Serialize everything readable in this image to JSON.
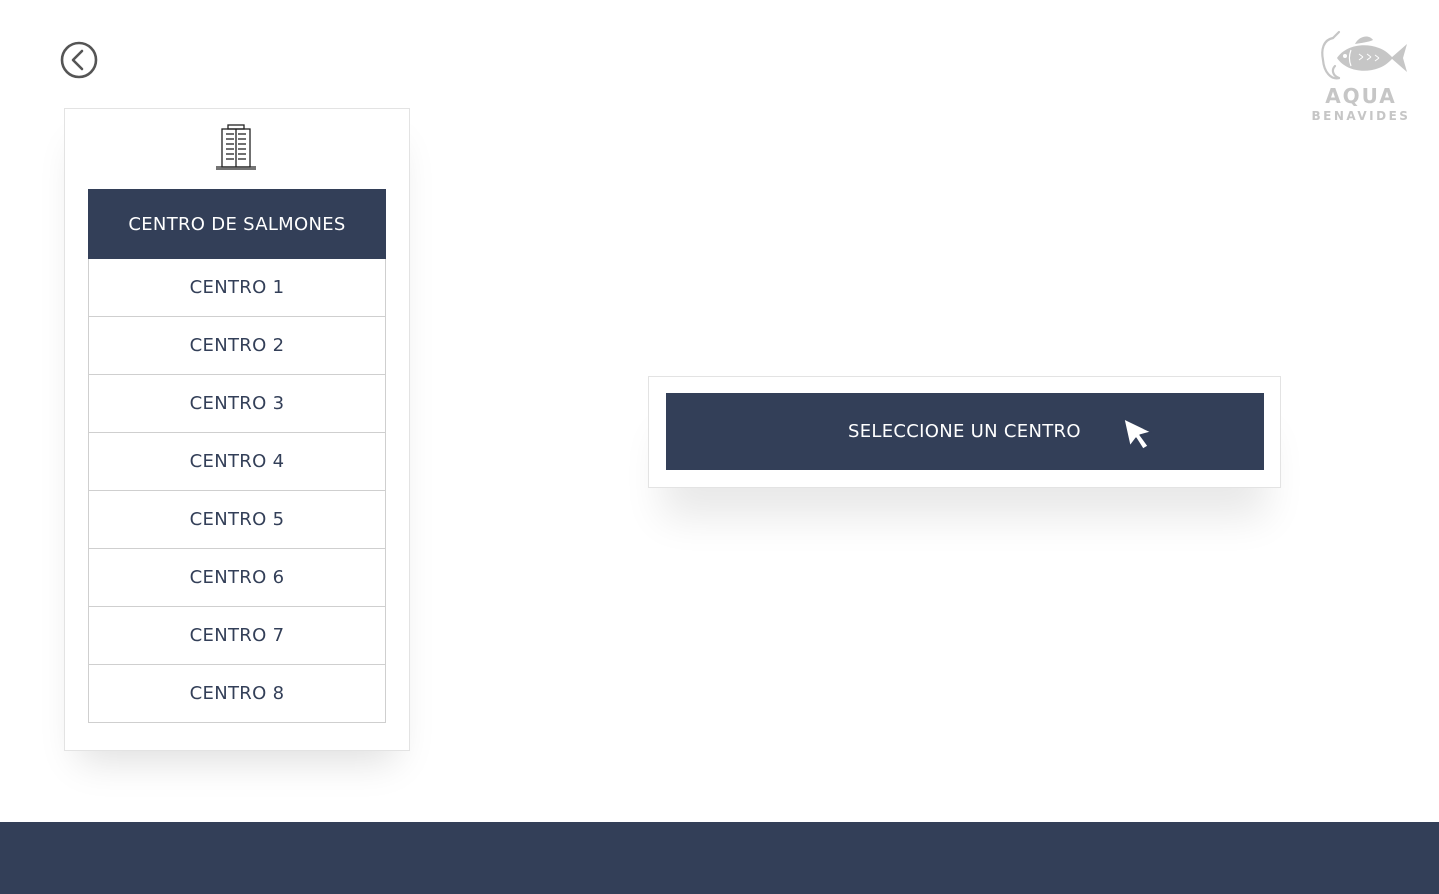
{
  "navigation": {
    "back_icon": "circle-chevron-left-icon"
  },
  "logo": {
    "icon": "fish-hook-icon",
    "name": "AQUA",
    "subtitle": "BENAVIDES"
  },
  "centers_panel": {
    "icon": "building-icon",
    "header": "CENTRO DE SALMONES",
    "items": [
      {
        "label": "CENTRO 1"
      },
      {
        "label": "CENTRO 2"
      },
      {
        "label": "CENTRO 3"
      },
      {
        "label": "CENTRO 4"
      },
      {
        "label": "CENTRO 5"
      },
      {
        "label": "CENTRO 6"
      },
      {
        "label": "CENTRO 7"
      },
      {
        "label": "CENTRO 8"
      }
    ]
  },
  "prompt": {
    "label": "SELECCIONE UN CENTRO",
    "icon": "mouse-pointer-icon"
  },
  "colors": {
    "primary": "#333f58",
    "logo_gray": "#c6c6c6",
    "border": "#cfcfcf",
    "background": "#ffffff"
  }
}
